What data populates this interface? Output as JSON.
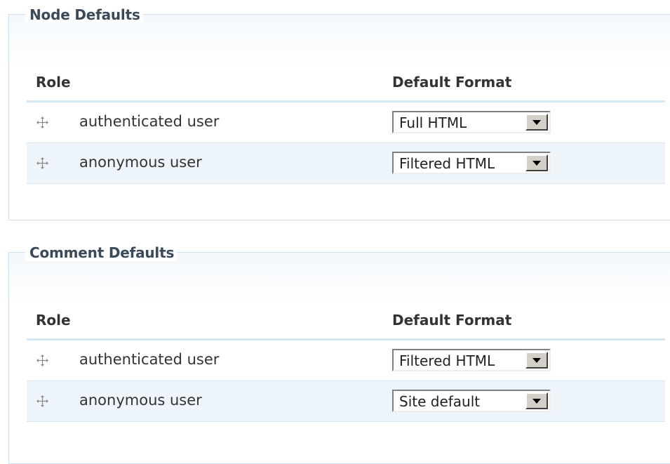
{
  "sections": [
    {
      "legend": "Node Defaults",
      "headers": {
        "role": "Role",
        "format": "Default Format"
      },
      "rows": [
        {
          "role": "authenticated user",
          "format": "Full HTML"
        },
        {
          "role": "anonymous user",
          "format": "Filtered HTML"
        }
      ]
    },
    {
      "legend": "Comment Defaults",
      "headers": {
        "role": "Role",
        "format": "Default Format"
      },
      "rows": [
        {
          "role": "authenticated user",
          "format": "Filtered HTML"
        },
        {
          "role": "anonymous user",
          "format": "Site default"
        }
      ]
    }
  ],
  "icons": {
    "drag": "drag-handle-icon",
    "dropdown": "chevron-down-icon"
  },
  "colors": {
    "border": "#cfe1ee",
    "row_alt": "#edf5fa",
    "header_rule": "#d3e7f4"
  }
}
